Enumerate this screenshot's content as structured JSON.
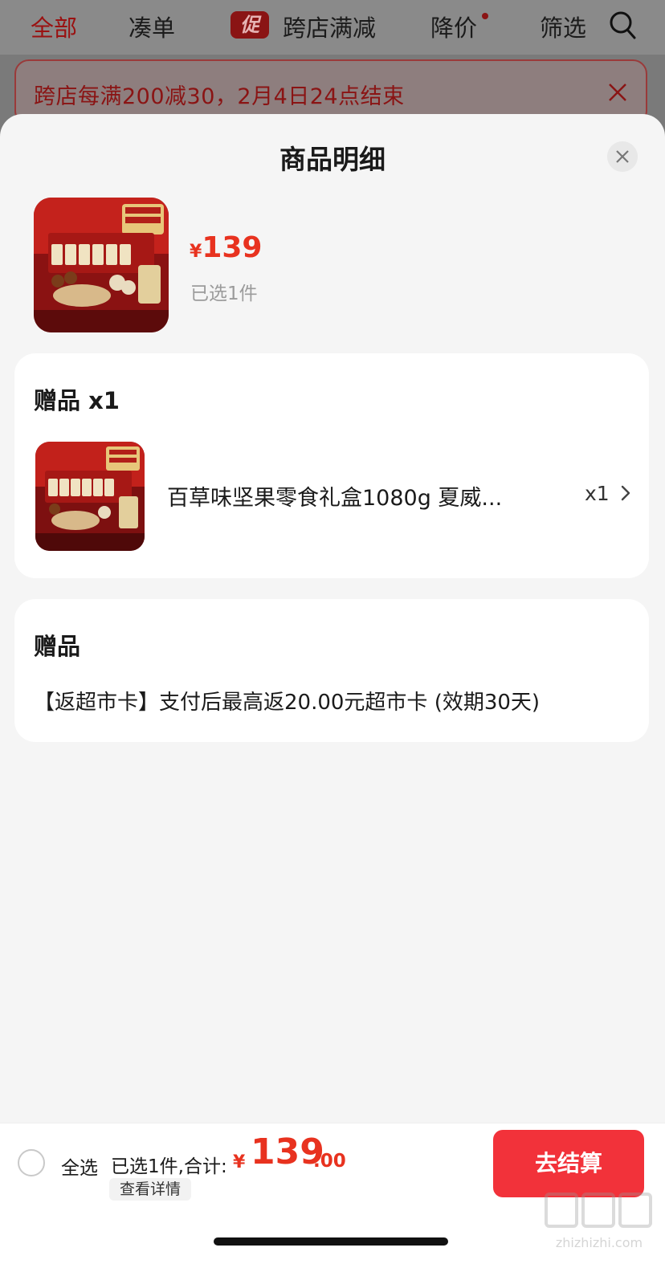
{
  "tabs": [
    {
      "label": "全部",
      "active": true
    },
    {
      "label": "凑单"
    },
    {
      "label": "跨店满减",
      "badge": "促"
    },
    {
      "label": "降价",
      "has_dot": true
    },
    {
      "label": "筛选"
    }
  ],
  "promo_notice": {
    "text": "跨店每满200减30，2月4日24点结束"
  },
  "sheet": {
    "title": "商品明细",
    "product": {
      "currency": "¥",
      "price": "139",
      "selected": "已选1件"
    },
    "gift_section": {
      "title": "赠品 x1",
      "item": {
        "name": "百草味坚果零食礼盒1080g 夏威...",
        "qty": "x1"
      }
    },
    "bonus_section": {
      "title": "赠品",
      "text": "【返超市卡】支付后最高返20.00元超市卡 (效期30天)"
    }
  },
  "bottom_bar": {
    "select_all": "全选",
    "summary_label": "已选1件,合计:",
    "total_currency": "¥",
    "total_integer": "139",
    "total_decimal": ".00",
    "details_button": "查看详情",
    "checkout_button": "去结算"
  },
  "watermark": {
    "text": "zhizhizhi.com"
  },
  "colors": {
    "accent": "#e8321f",
    "checkout": "#f2323a"
  }
}
